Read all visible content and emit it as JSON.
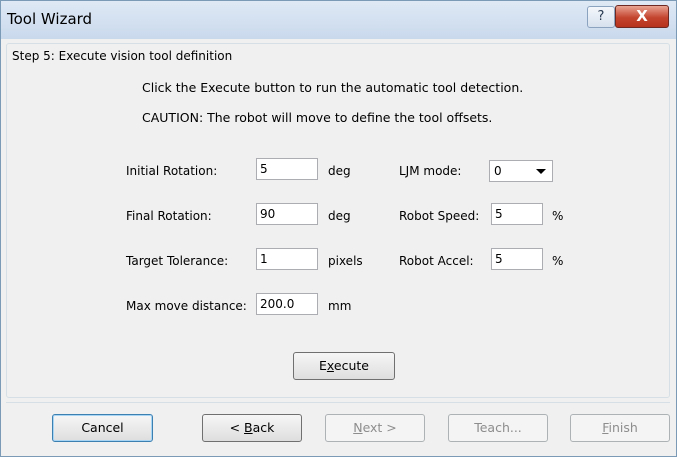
{
  "window": {
    "title": "Tool Wizard",
    "help_label": "?",
    "close_label": "X"
  },
  "group": {
    "title": "Step 5: Execute vision tool definition"
  },
  "info": {
    "line1": "Click the Execute button to run the automatic tool detection.",
    "line2": "CAUTION: The robot will move to define the tool offsets."
  },
  "fields": {
    "initial_rotation": {
      "label": "Initial Rotation:",
      "value": "5",
      "unit": "deg"
    },
    "final_rotation": {
      "label": "Final Rotation:",
      "value": "90",
      "unit": "deg"
    },
    "target_tolerance": {
      "label": "Target Tolerance:",
      "value": "1",
      "unit": "pixels"
    },
    "max_move_distance": {
      "label": "Max move distance:",
      "value": "200.0",
      "unit": "mm"
    },
    "ljm_mode": {
      "label": "LJM mode:",
      "value": "0"
    },
    "robot_speed": {
      "label": "Robot Speed:",
      "value": "5",
      "unit": "%"
    },
    "robot_accel": {
      "label": "Robot Accel:",
      "value": "5",
      "unit": "%"
    }
  },
  "buttons": {
    "execute_pre": "E",
    "execute_mnemonic": "x",
    "execute_post": "ecute",
    "cancel": "Cancel",
    "back_pre": "< ",
    "back_mnemonic": "B",
    "back_post": "ack",
    "next_mnemonic": "N",
    "next_post": "ext >",
    "teach": "Teach...",
    "finish_mnemonic": "F",
    "finish_post": "inish"
  }
}
